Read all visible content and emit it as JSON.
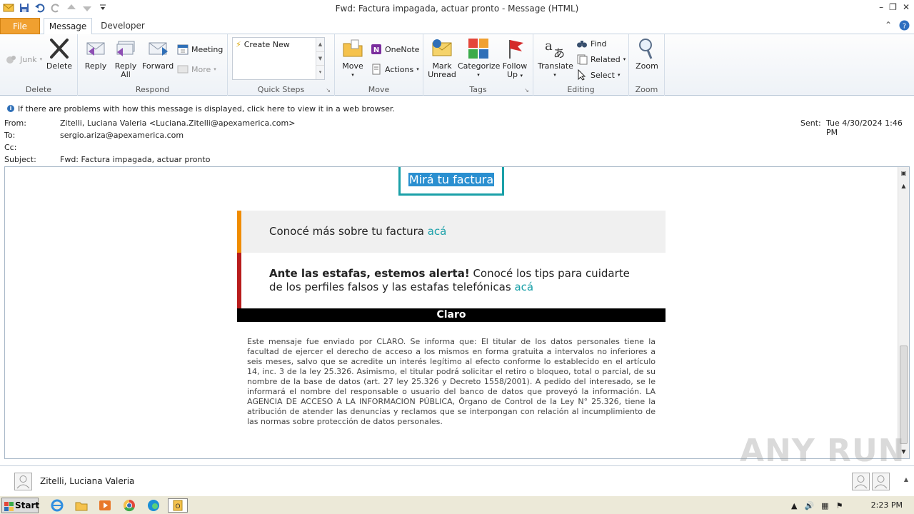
{
  "window": {
    "title": "Fwd: Factura impagada, actuar pronto  -  Message (HTML)"
  },
  "tabs": {
    "file": "File",
    "message": "Message",
    "developer": "Developer"
  },
  "ribbon": {
    "delete_group": {
      "label": "Delete",
      "junk": "Junk",
      "delete": "Delete"
    },
    "respond_group": {
      "label": "Respond",
      "reply": "Reply",
      "reply_all_1": "Reply",
      "reply_all_2": "All",
      "forward": "Forward",
      "meeting": "Meeting",
      "more": "More"
    },
    "quicksteps_group": {
      "label": "Quick Steps",
      "create_new": "Create New"
    },
    "move_group": {
      "label": "Move",
      "move": "Move",
      "onenote": "OneNote",
      "actions": "Actions"
    },
    "tags_group": {
      "label": "Tags",
      "mark_unread_1": "Mark",
      "mark_unread_2": "Unread",
      "categorize": "Categorize",
      "follow_up_1": "Follow",
      "follow_up_2": "Up"
    },
    "editing_group": {
      "label": "Editing",
      "translate": "Translate",
      "find": "Find",
      "related": "Related",
      "select": "Select"
    },
    "zoom_group": {
      "label": "Zoom",
      "zoom": "Zoom"
    }
  },
  "infobar": {
    "text": "If there are problems with how this message is displayed, click here to view it in a web browser."
  },
  "headers": {
    "from_label": "From:",
    "from_value": "Zitelli, Luciana Valeria <Luciana.Zitelli@apexamerica.com>",
    "to_label": "To:",
    "to_value": "sergio.ariza@apexamerica.com",
    "cc_label": "Cc:",
    "subject_label": "Subject:",
    "subject_value": "Fwd: Factura impagada, actuar pronto",
    "sent_label": "Sent:",
    "sent_value": "Tue 4/30/2024 1:46 PM"
  },
  "body": {
    "cta": "Mirá tu factura",
    "card1_text": "Conocé más sobre tu factura ",
    "card1_link": "acá",
    "card2_bold": "Ante las estafas, estemos alerta!",
    "card2_text": " Conocé los tips para cuidarte de los perfiles falsos y las estafas telefónicas ",
    "card2_link": "acá",
    "brand_bar": "Claro",
    "legal": "Este mensaje fue enviado por CLARO. Se informa que: El titular de los datos personales tiene la facultad de ejercer el derecho de acceso a los mismos en forma gratuita a intervalos no inferiores a seis meses, salvo que se acredite un interés legítimo al efecto conforme lo establecido en el artículo 14, inc. 3 de la ley 25.326. Asimismo, el titular podrá solicitar el retiro o bloqueo, total o parcial, de su nombre de la base de datos (art. 27 ley 25.326 y Decreto 1558/2001). A pedido del interesado, se le informará el nombre del responsable o usuario del banco de datos que proveyó la información. LA AGENCIA DE ACCESO A LA INFORMACION PÚBLICA, Órgano de Control de la Ley N° 25.326, tiene la atribución de atender las denuncias y reclamos que se interpongan con relación al incumplimiento de las normas sobre protección de datos personales."
  },
  "people_pane": {
    "name": "Zitelli, Luciana Valeria"
  },
  "taskbar": {
    "start": "Start",
    "clock": "2:23 PM"
  },
  "watermark": "ANY RUN",
  "colors": {
    "file_tab": "#f0a030",
    "accent_teal": "#1aa0a8",
    "card1_border": "#f08c00",
    "card2_border": "#b81c1c",
    "cta_highlight": "#2a8fd0"
  }
}
